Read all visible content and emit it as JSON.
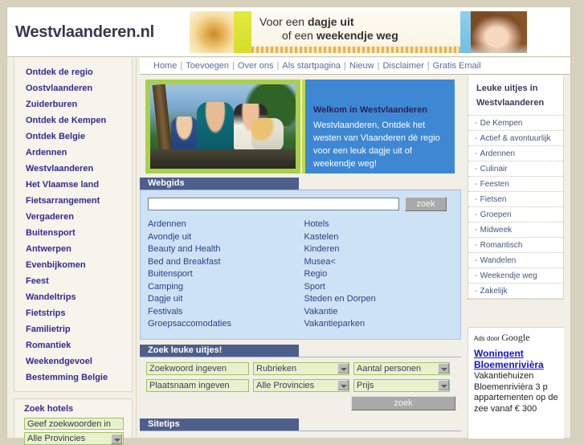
{
  "site": {
    "logo": "Westvlaanderen.nl"
  },
  "banner": {
    "line1_pre": "Voor een ",
    "line1_bold": "dagje uit",
    "line2_pre": "of een ",
    "line2_bold": "weekendje weg"
  },
  "topnav": {
    "items": [
      {
        "label": "Home"
      },
      {
        "label": "Toevoegen"
      },
      {
        "label": "Over ons"
      },
      {
        "label": "Als startpagina"
      },
      {
        "label": "Nieuw"
      },
      {
        "label": "Disclaimer"
      },
      {
        "label": "Gratis Email"
      }
    ],
    "separator": "|"
  },
  "left_sidebar": {
    "items": [
      {
        "label": "Ontdek de regio"
      },
      {
        "label": "Oostvlaanderen"
      },
      {
        "label": "Zuiderburen"
      },
      {
        "label": "Ontdek de Kempen"
      },
      {
        "label": "Ontdek Belgie"
      },
      {
        "label": "Ardennen"
      },
      {
        "label": "Westvlaanderen"
      },
      {
        "label": "Het Vlaamse land"
      },
      {
        "label": "Fietsarrangement"
      },
      {
        "label": "Vergaderen"
      },
      {
        "label": "Buitensport"
      },
      {
        "label": "Antwerpen"
      },
      {
        "label": "Evenbijkomen"
      },
      {
        "label": "Feest"
      },
      {
        "label": "Wandeltrips"
      },
      {
        "label": "Fietstrips"
      },
      {
        "label": "Familietrip"
      },
      {
        "label": "Romantiek"
      },
      {
        "label": "Weekendgevoel"
      },
      {
        "label": "Bestemming Belgie"
      }
    ],
    "hotels": {
      "title": "Zoek hotels",
      "keyword_value": "Geef zoekwoorden in",
      "keyword_placeholder": "Geef zoekwoorden in",
      "province_value": "Alle Provincies"
    }
  },
  "hero": {
    "photo_alt": "family-outdoors-photo",
    "welcome_title": "Welkom in Westvlaanderen",
    "welcome_body": "Westvlaanderen, Ontdek het westen van Vlaanderen dè regio voor een leuk dagje uit of weekendje weg!"
  },
  "webgids": {
    "title": "Webgids",
    "search_value": "",
    "search_placeholder": "",
    "search_button": "zoek",
    "links_col1": [
      "Ardennen",
      "Avondje uit",
      "Beauty and Health",
      "Bed and Breakfast",
      "Buitensport",
      "Camping",
      "Dagje uit",
      "Festivals",
      "Groepsaccomodaties"
    ],
    "links_col2": [
      "Hotels",
      "Kastelen",
      "Kinderen",
      "Musea<",
      "Regio",
      "Sport",
      "Steden en Dorpen",
      "Vakantie",
      "Vakantieparken"
    ]
  },
  "uitjes": {
    "title": "Zoek leuke uitjes!",
    "keyword_value": "Zoekwoord ingeven",
    "keyword_placeholder": "Zoekwoord ingeven",
    "place_value": "Plaatsnaam ingeven",
    "place_placeholder": "Plaatsnaam ingeven",
    "rubrieken_value": "Rubrieken",
    "provincies_value": "Alle Provincies",
    "personen_value": "Aantal personen",
    "prijs_value": "Prijs",
    "search_button": "zoek"
  },
  "sitetips": {
    "title": "Sitetips"
  },
  "right_sidebar": {
    "head_line1": "Leuke uitjes in",
    "head_line2": "Westvlaanderen",
    "dash": "-",
    "items": [
      {
        "label": "De Kempen"
      },
      {
        "label": "Actief & avontuurlijk"
      },
      {
        "label": "Ardennen"
      },
      {
        "label": "Culinair"
      },
      {
        "label": "Feesten"
      },
      {
        "label": "Fietsen"
      },
      {
        "label": "Groepen"
      },
      {
        "label": "Midweek"
      },
      {
        "label": "Romantisch"
      },
      {
        "label": "Wandelen"
      },
      {
        "label": "Weekendje weg"
      },
      {
        "label": "Zakelijk"
      }
    ]
  },
  "google_ads": {
    "label_pre": "Ads door ",
    "label_brand": "Google",
    "ad_title_line1": "Woningent",
    "ad_title_line2": "Bloemenrivièra",
    "ad_body": "Vakantiehuizen Bloemenrivièra 3 p appartementen op de zee vanaf € 300"
  },
  "colors": {
    "page_background": "#d8d1bd",
    "section_header": "#4d5f8b",
    "panel_blue": "#cde3f5",
    "welcome_blue": "#3e87d3",
    "accent_lime": "#c5d93f",
    "link_blue": "#2a3f86",
    "sidebar_link": "#312c8e",
    "green_input": "#e7f2cd",
    "green_border": "#9ec35c"
  }
}
